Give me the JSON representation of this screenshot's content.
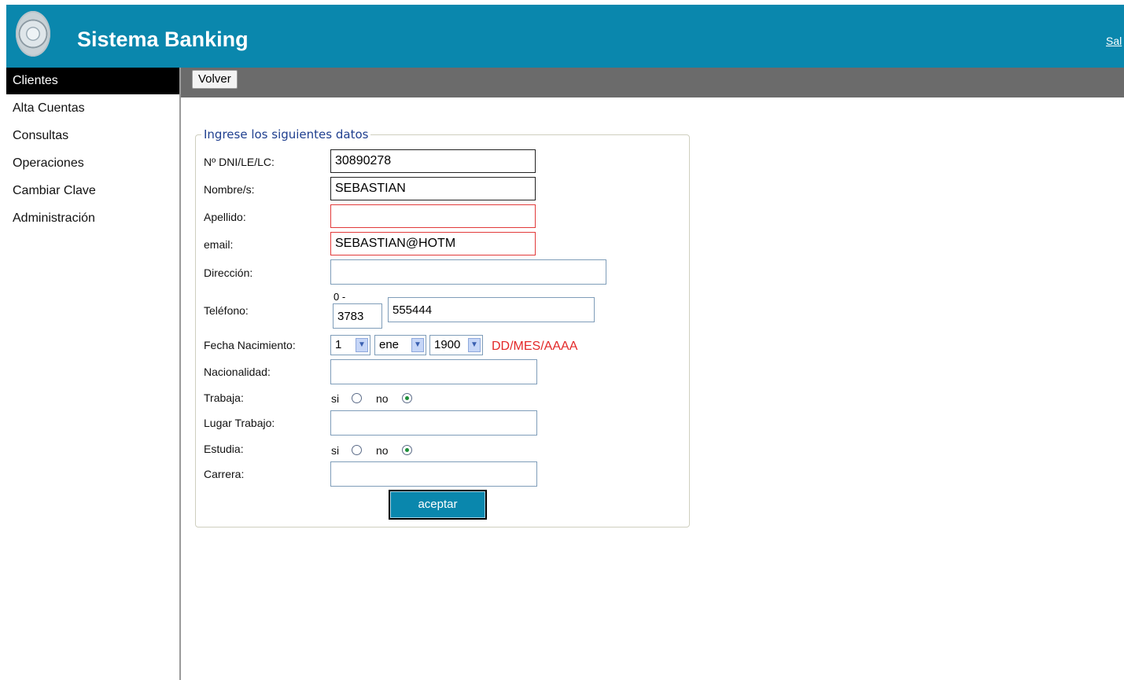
{
  "header": {
    "app_title": "Sistema Banking",
    "logout_label": "Sal"
  },
  "sidebar": {
    "items": [
      {
        "label": "Clientes",
        "active": true
      },
      {
        "label": "Alta Cuentas"
      },
      {
        "label": "Consultas"
      },
      {
        "label": "Operaciones"
      },
      {
        "label": "Cambiar Clave"
      },
      {
        "label": "Administración"
      }
    ]
  },
  "toolbar": {
    "back_label": "Volver"
  },
  "form": {
    "legend": "Ingrese los siguientes datos",
    "dni": {
      "label": "Nº DNI/LE/LC:",
      "value": "30890278"
    },
    "nombre": {
      "label": "Nombre/s:",
      "value": "SEBASTIAN"
    },
    "apellido": {
      "label": "Apellido:",
      "value": ""
    },
    "email": {
      "label": "email:",
      "value": "SEBASTIAN@HOTM"
    },
    "direccion": {
      "label": "Dirección:",
      "value": ""
    },
    "telefono": {
      "label": "Teléfono:",
      "prefix_label": "0 -",
      "area_code": "3783",
      "number": "555444"
    },
    "fecha": {
      "label": "Fecha Nacimiento:",
      "day": "1",
      "month": "ene",
      "year": "1900",
      "format_hint": "DD/MES/AAAA"
    },
    "nacionalidad": {
      "label": "Nacionalidad:",
      "value": ""
    },
    "trabaja": {
      "label": "Trabaja:",
      "yes_label": "si",
      "no_label": "no",
      "selected": "no"
    },
    "lugar_trabajo": {
      "label": "Lugar Trabajo:",
      "value": ""
    },
    "estudia": {
      "label": "Estudia:",
      "yes_label": "si",
      "no_label": "no",
      "selected": "no"
    },
    "carrera": {
      "label": "Carrera:",
      "value": ""
    },
    "submit_label": "aceptar"
  },
  "colors": {
    "header_bg": "#0a87ad",
    "toolbar_bg": "#6b6b6b",
    "error_border": "#e23a3a",
    "hint_red": "#e32828"
  }
}
